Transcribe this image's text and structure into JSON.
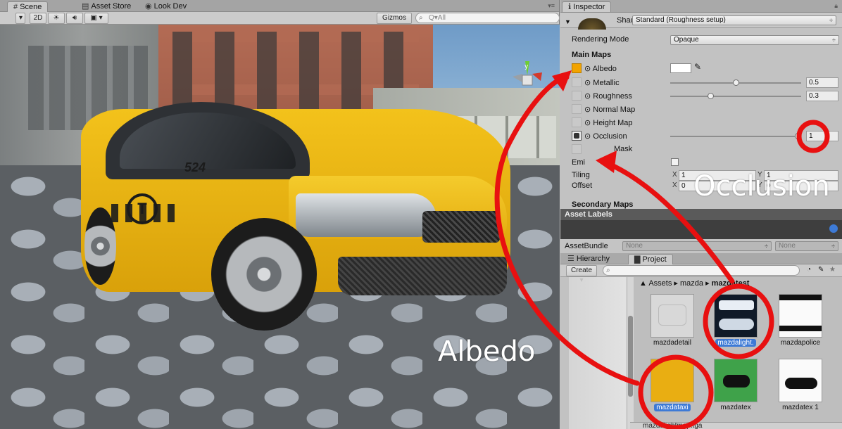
{
  "scene": {
    "tabs": [
      {
        "label": "Scene",
        "icon": "hash-icon"
      },
      {
        "label": "Asset Store",
        "icon": "store-icon"
      },
      {
        "label": "Look Dev",
        "icon": "eye-icon"
      }
    ],
    "toolbar": {
      "mode_2d": "2D",
      "gizmos_label": "Gizmos",
      "search_placeholder": "Q▾All"
    },
    "car_number": "524",
    "taxi_logo": "T"
  },
  "inspector": {
    "tab_label": "Inspector",
    "shader_label": "Shader",
    "shader_value": "Standard (Roughness setup)",
    "rendering_mode_label": "Rendering Mode",
    "rendering_mode_value": "Opaque",
    "main_maps_label": "Main Maps",
    "props": [
      {
        "label": "Albedo"
      },
      {
        "label": "Metallic",
        "value": "0.5",
        "level": 0.5
      },
      {
        "label": "Roughness",
        "value": "0.3",
        "level": 0.3
      },
      {
        "label": "Normal Map"
      },
      {
        "label": "Height Map"
      },
      {
        "label": "Occlusion",
        "value": "1",
        "level": 1.0
      },
      {
        "label": "Mask"
      }
    ],
    "emission_label": "Emi",
    "tiling_label": "Tiling",
    "offset_label": "Offset",
    "tiling_x": "1",
    "tiling_y": "1",
    "offset_x": "0",
    "offset_y": "0",
    "axis_x": "X",
    "axis_y": "Y",
    "secondary_maps_label": "Secondary Maps",
    "albedo_color": "#ffffff",
    "albedo_slot_color": "#f2a300"
  },
  "asset_labels": {
    "header": "Asset Labels",
    "assetbundle_label": "AssetBundle",
    "bundle_value": "None",
    "variant_value": "None"
  },
  "project": {
    "tabs": [
      {
        "label": "Hierarchy",
        "icon": "hierarchy-icon"
      },
      {
        "label": "Project",
        "icon": "folder-icon"
      }
    ],
    "create_label": "Create",
    "breadcrumb": [
      "Assets",
      "mazda",
      "mazdatest"
    ],
    "assets": [
      {
        "name": "mazdadetail",
        "selected": false
      },
      {
        "name": "mazdalight.",
        "selected": true
      },
      {
        "name": "mazdapolice",
        "selected": false
      },
      {
        "name": "mazdataxi",
        "selected": true
      },
      {
        "name": "mazdatex",
        "selected": false
      },
      {
        "name": "mazdatex 1",
        "selected": false
      }
    ],
    "status_file": "mazdalightmap.tga"
  },
  "annotations": {
    "occlusion": "Occlusion",
    "albedo": "Albedo",
    "accent": "#e81010"
  }
}
